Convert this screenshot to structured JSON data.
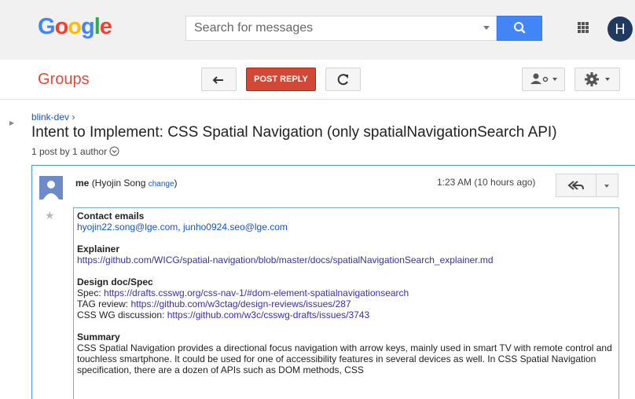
{
  "header": {
    "logo_letters": [
      "G",
      "o",
      "o",
      "g",
      "l",
      "e"
    ],
    "search_placeholder": "Search for messages",
    "avatar_letter": "H"
  },
  "toolbar": {
    "section_title": "Groups",
    "post_reply_label": "POST REPLY"
  },
  "thread": {
    "breadcrumb": "blink-dev ›",
    "title": "Intent to Implement: CSS Spatial Navigation (only spatialNavigationSearch API)",
    "meta": "1 post by 1 author"
  },
  "message": {
    "author_me": "me",
    "author_name": "(Hyojin Song",
    "change_label": "change",
    "author_close": ")",
    "time": "1:23 AM (10 hours ago)",
    "contact_heading": "Contact emails",
    "contact_email_1": "hyojin22.song@lge.com",
    "contact_sep": ", ",
    "contact_email_2": "junho0924.seo@lge.com",
    "explainer_heading": "Explainer",
    "explainer_link": "https://github.com/WICG/spatial-navigation/blob/master/docs/spatialNavigationSearch_explainer.md",
    "design_heading": "Design doc/Spec",
    "spec_label": "Spec: ",
    "spec_link": "https://drafts.csswg.org/css-nav-1/#dom-element-spatialnavigationsearch",
    "tag_label": "TAG review: ",
    "tag_link": "https://github.com/w3ctag/design-reviews/issues/287",
    "csswg_label": "CSS WG discussion: ",
    "csswg_link": "https://github.com/w3c/csswg-drafts/issues/3743",
    "summary_heading": "Summary",
    "summary_text": "CSS Spatial Navigation provides a directional focus navigation with arrow keys, mainly used in smart TV with remote control and touchless smartphone. It could be used for one of accessibility features in several devices as well. In CSS Spatial Navigation specification, there are a dozen of APIs such as DOM methods, CSS"
  },
  "icons": [
    "search-icon",
    "apps-icon",
    "back-arrow-icon",
    "refresh-icon",
    "people-settings-icon",
    "gear-icon",
    "expand-circle-icon",
    "avatar-icon",
    "reply-all-icon",
    "chevron-down-icon",
    "star-icon"
  ],
  "colors": {
    "accent_blue": "#4285f4",
    "post_red": "#d14836",
    "groups_red": "#dd4b39",
    "link_blue": "#1155cc"
  }
}
